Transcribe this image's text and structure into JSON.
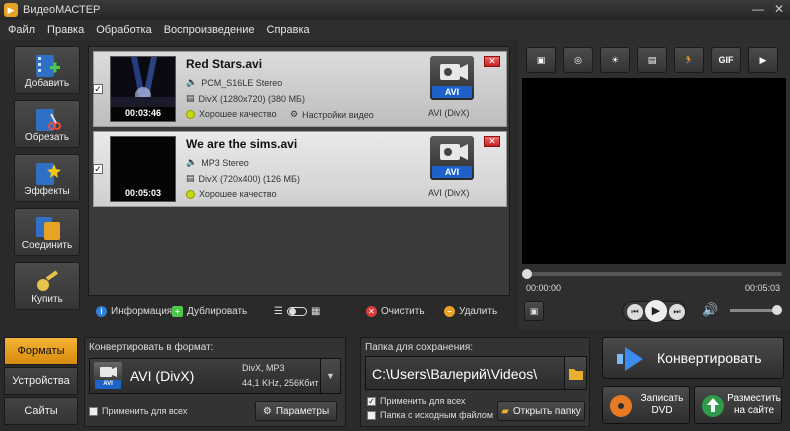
{
  "window": {
    "title": "ВидеоМАСТЕР",
    "app_icon": "video-master-icon",
    "accent": "#f0a424"
  },
  "menu": [
    "Файл",
    "Правка",
    "Обработка",
    "Воспроизведение",
    "Справка"
  ],
  "toolbar": {
    "add": "Добавить",
    "cut": "Обрезать",
    "effects": "Эффекты",
    "join": "Соединить",
    "buy": "Купить"
  },
  "files": [
    {
      "name": "Red Stars.avi",
      "duration": "00:03:46",
      "audio": "PCM_S16LE Stereo",
      "video": "DivX (1280x720) (380 МБ)",
      "quality": "Хорошее качество",
      "video_settings": "Настройки видео",
      "format_badge": "AVI",
      "format_name": "AVI (DivX)"
    },
    {
      "name": "We are the sims.avi",
      "duration": "00:05:03",
      "audio": "MP3 Stereo",
      "video": "DivX (720x400) (126 МБ)",
      "quality": "Хорошее качество",
      "format_badge": "AVI",
      "format_name": "AVI (DivX)"
    }
  ],
  "list_footer": {
    "info": "Информация",
    "duplicate": "Дублировать",
    "clear": "Очистить",
    "delete": "Удалить"
  },
  "player": {
    "current_time": "00:00:00",
    "total_time": "00:05:03",
    "gif_label": "GIF"
  },
  "tabs": [
    "Форматы",
    "Устройства",
    "Сайты"
  ],
  "convert_panel": {
    "title": "Конвертировать в формат:",
    "format": "AVI (DivX)",
    "badge": "AVI",
    "codec": "DivX, MP3",
    "audio": "44,1 KHz, 256Кбит",
    "apply_all": "Применить для всех",
    "params": "Параметры"
  },
  "folder_panel": {
    "title": "Папка для сохранения:",
    "path": "C:\\Users\\Валерий\\Videos\\",
    "apply_all": "Применить для всех",
    "source_folder": "Папка с исходным файлом",
    "open_folder": "Открыть папку"
  },
  "actions": {
    "convert": "Конвертировать",
    "burn_dvd": "Записать DVD",
    "publish": "Разместить на сайте"
  }
}
